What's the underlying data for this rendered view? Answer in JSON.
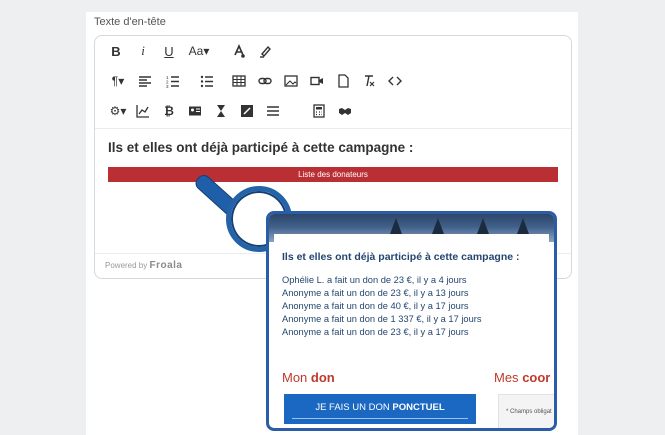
{
  "header_label": "Texte d'en-tête",
  "toolbar": {
    "row1": [
      {
        "name": "bold-button",
        "text": "B",
        "icon": "bold"
      },
      {
        "name": "italic-button",
        "text": "i",
        "icon": "italic"
      },
      {
        "name": "underline-button",
        "text": "U",
        "icon": "underline"
      },
      {
        "name": "font-size-button",
        "text": "Aa▾",
        "icon": "font-size"
      },
      {
        "name": "text-color-button",
        "text": "",
        "icon": "text-color-icon"
      },
      {
        "name": "highlight-button",
        "text": "",
        "icon": "highlighter-icon"
      }
    ],
    "row2": [
      "paragraph-format",
      "align",
      "ordered-list",
      "unordered-list",
      "insert-table",
      "insert-link",
      "insert-image",
      "insert-video",
      "insert-file",
      "clear-formatting",
      "code-view"
    ],
    "row3": [
      "settings",
      "chart",
      "bitcoin",
      "contact-card",
      "hourglass",
      "image-edit",
      "menu",
      "calculator",
      "handshake"
    ]
  },
  "editor": {
    "heading": "Ils et elles ont déjà participé à cette campagne :",
    "donors_bar": "Liste des donateurs",
    "powered_by": "Powered by",
    "brand": "Froala"
  },
  "preview": {
    "heading": "Ils et elles ont déjà participé à cette campagne :",
    "donations": [
      "Ophélie L. a fait un don de 23 €, il y a 4 jours",
      "Anonyme a fait un don de 23 €, il y a 13 jours",
      "Anonyme a fait un don de 40 €, il y a 17 jours",
      "Anonyme a fait un don de 1 337 €, il y a 17 jours",
      "Anonyme a fait un don de 23 €, il y a 17 jours"
    ],
    "mon_label": "Mon",
    "don_label": "don",
    "mes_label": "Mes",
    "coo_label": "coor",
    "button_prefix": "JE FAIS UN DON",
    "button_strong": "PONCTUEL",
    "champs": "* Champs obligat"
  },
  "colors": {
    "accent_red": "#b92f34",
    "brand_blue": "#1a68c1",
    "navy_text": "#24466f"
  }
}
